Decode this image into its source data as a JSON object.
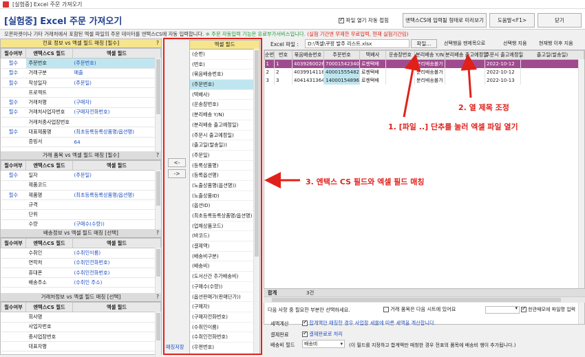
{
  "window": {
    "title": "[실험중] Excel 주문 가져오기"
  },
  "header": {
    "title": "[실험중] Excel 주문 가져오기",
    "auto_close_label": "파일 열기 자동 접힘",
    "preview_label": "엔택스CS에 입력될 형태로 미리보기",
    "help_label": "도움말<F1>",
    "close_label": "닫기"
  },
  "notice": {
    "part1": "오픈마켓이나 기타 거래처에서 포함된 엑셀 파일의 주문 데이터를 엔택스CS에 자동 입력합니다.",
    "part2": "※ 주문 자동입력 기능은 유료부가서비스입니다.",
    "part3": "(실험 기간엔 무제한 무료입력, 현재 실험기간임)"
  },
  "left": {
    "section1_title": "전표 정보 vs 엑셀 필드 매칭 [필수]",
    "col_required": "필수여부",
    "col_cs": "엔택스CS 필드",
    "col_excel": "엑셀 필드",
    "section1_rows": [
      {
        "req": "필수",
        "cs": "주문번호",
        "ex": "(주문번호)"
      },
      {
        "req": "필수",
        "cs": "거래구분",
        "ex": "매출"
      },
      {
        "req": "필수",
        "cs": "작성일자",
        "ex": "(주문일)"
      },
      {
        "req": "",
        "cs": "프로젝트",
        "ex": ""
      },
      {
        "req": "필수",
        "cs": "거래처명",
        "ex": "(구매자)"
      },
      {
        "req": "필수",
        "cs": "거래처사업자번호",
        "ex": "(구매자전화번호)"
      },
      {
        "req": "",
        "cs": "거래처종사업장번호",
        "ex": ""
      },
      {
        "req": "필수",
        "cs": "대표제품명",
        "ex": "(최초등록등록상품명/옵션명)"
      },
      {
        "req": "",
        "cs": "증빙서",
        "ex": "64"
      }
    ],
    "section2_title": "거래 품목 vs 엑셀 필드 매칭 [필수]",
    "section2_rows": [
      {
        "req": "필수",
        "cs": "일자",
        "ex": "(주문일)"
      },
      {
        "req": "",
        "cs": "제품코드",
        "ex": ""
      },
      {
        "req": "필수",
        "cs": "제품명",
        "ex": "(최초등록등록상품명/옵션명)"
      },
      {
        "req": "",
        "cs": "규격",
        "ex": ""
      },
      {
        "req": "",
        "cs": "단위",
        "ex": ""
      },
      {
        "req": "",
        "cs": "수량",
        "ex": "(구매수(수량))"
      }
    ],
    "section3_title": "배송정보 vs 엑셀 필드 매칭 [선택]",
    "section3_rows": [
      {
        "req": "",
        "cs": "수취인",
        "ex": "(수취인이름)"
      },
      {
        "req": "",
        "cs": "연락처",
        "ex": "(수취인전화번호)"
      },
      {
        "req": "",
        "cs": "휴대폰",
        "ex": "(수취인전화번호)"
      },
      {
        "req": "",
        "cs": "배송주소",
        "ex": "(수취인 주소)"
      }
    ],
    "section4_title": "거래처정보 vs 엑셀 필드 매칭 [선택]",
    "section4_rows": [
      {
        "req": "",
        "cs": "회사명",
        "ex": ""
      },
      {
        "req": "",
        "cs": "사업자번호",
        "ex": ""
      },
      {
        "req": "",
        "cs": "종사업장번호",
        "ex": ""
      },
      {
        "req": "",
        "cs": "대표자명",
        "ex": ""
      }
    ]
  },
  "middle": {
    "btn_left": "<-",
    "btn_right": "->",
    "save_label": "매칭저장",
    "list_title": "엑셀 필드",
    "items": [
      "(순번)",
      "(번호)",
      "(묶음배송번호)",
      "(주문번호)",
      "(택배사)",
      "(운송장번호)",
      "(분리배송 Y/N)",
      "(분리배송 출고예정일)",
      "(주문시 출고예정일)",
      "(출고일(발송일))",
      "(주문일)",
      "(등록상품명)",
      "(등록옵션명)",
      "(노출상품명(옵션명))",
      "(노출상품ID)",
      "(옵션ID)",
      "(최초등록등록상품명/옵션명)",
      "(업체상품코드)",
      "(바코드)",
      "(결제액)",
      "(배송비구분)",
      "(배송비)",
      "(도서산간 추가배송비)",
      "(구매수(수량))",
      "(옵션판매가(판매단가))",
      "(구매자)",
      "(구매자전화번호)",
      "(수취인이름)",
      "(수취인전화번호)",
      "(우편번호)",
      "(수취인 주소)"
    ]
  },
  "right": {
    "file_label": "Excel 파일 :",
    "file_path": "D:\\엑셀\\쿠팡 발주 리스트.xlsx",
    "file_button": "파일...",
    "toolbar": [
      "선택행을 맨제목으로",
      "선택행 지움",
      "현재행 이후 지움"
    ],
    "columns": [
      "순번",
      "번호",
      "묶음배송번호",
      "주문번호",
      "택배사",
      "운송장번호",
      "분리배송 Y/N",
      "분리배송 출고예정일",
      "주문시 출고예정일",
      "출고일(발송일)"
    ],
    "rows": [
      [
        "1",
        "1",
        "4039260026",
        "7000154234059",
        "로젠택배",
        "",
        "분리배송불가",
        "",
        "2022-10-12",
        ""
      ],
      [
        "2",
        "2",
        "4039914118",
        "4000155548205",
        "로젠택배",
        "",
        "분리배송불가",
        "",
        "2022-10-12",
        ""
      ],
      [
        "3",
        "3",
        "4041431364",
        "14000154896147",
        "로젠택배",
        "",
        "분리배송불가",
        "",
        "2022-10-13",
        ""
      ]
    ],
    "total_label": "합계",
    "total_value": "3건",
    "help_text": "다음 사항 중 필요한 부분만 선택하세요.",
    "next_sheet_label": "거래 품목은 다음 시트에 있어요",
    "column_input_label": "한관매모에 파일명 입력",
    "tax_label": "세액계산",
    "tax_text": "합계액만 매칭한 경우 사업장 세율에 따른 세액을 계산합니다.",
    "payment_label": "결제완료",
    "payment_text": "결제완료로 처리",
    "shipping_label": "배송비 필드",
    "shipping_value": "배송비",
    "shipping_note": "(이 필드를 지정하고 합계액만 매칭한 경우 전표의 품목에 배송비 행이 추가됩니다.)"
  },
  "annotations": {
    "a1": "1. [파일 ..] 단추를 눌러 엑셀 파일 열기",
    "a2": "2. 열 제목 조정",
    "a3": "3. 엔택스 CS 필드와 엑셀 필드 매칭"
  },
  "colors": {
    "accent_red": "#e0211a",
    "required_blue": "#1f4fbf",
    "selected_row": "#a04b8f",
    "yellow_header": "#f6e58d"
  }
}
